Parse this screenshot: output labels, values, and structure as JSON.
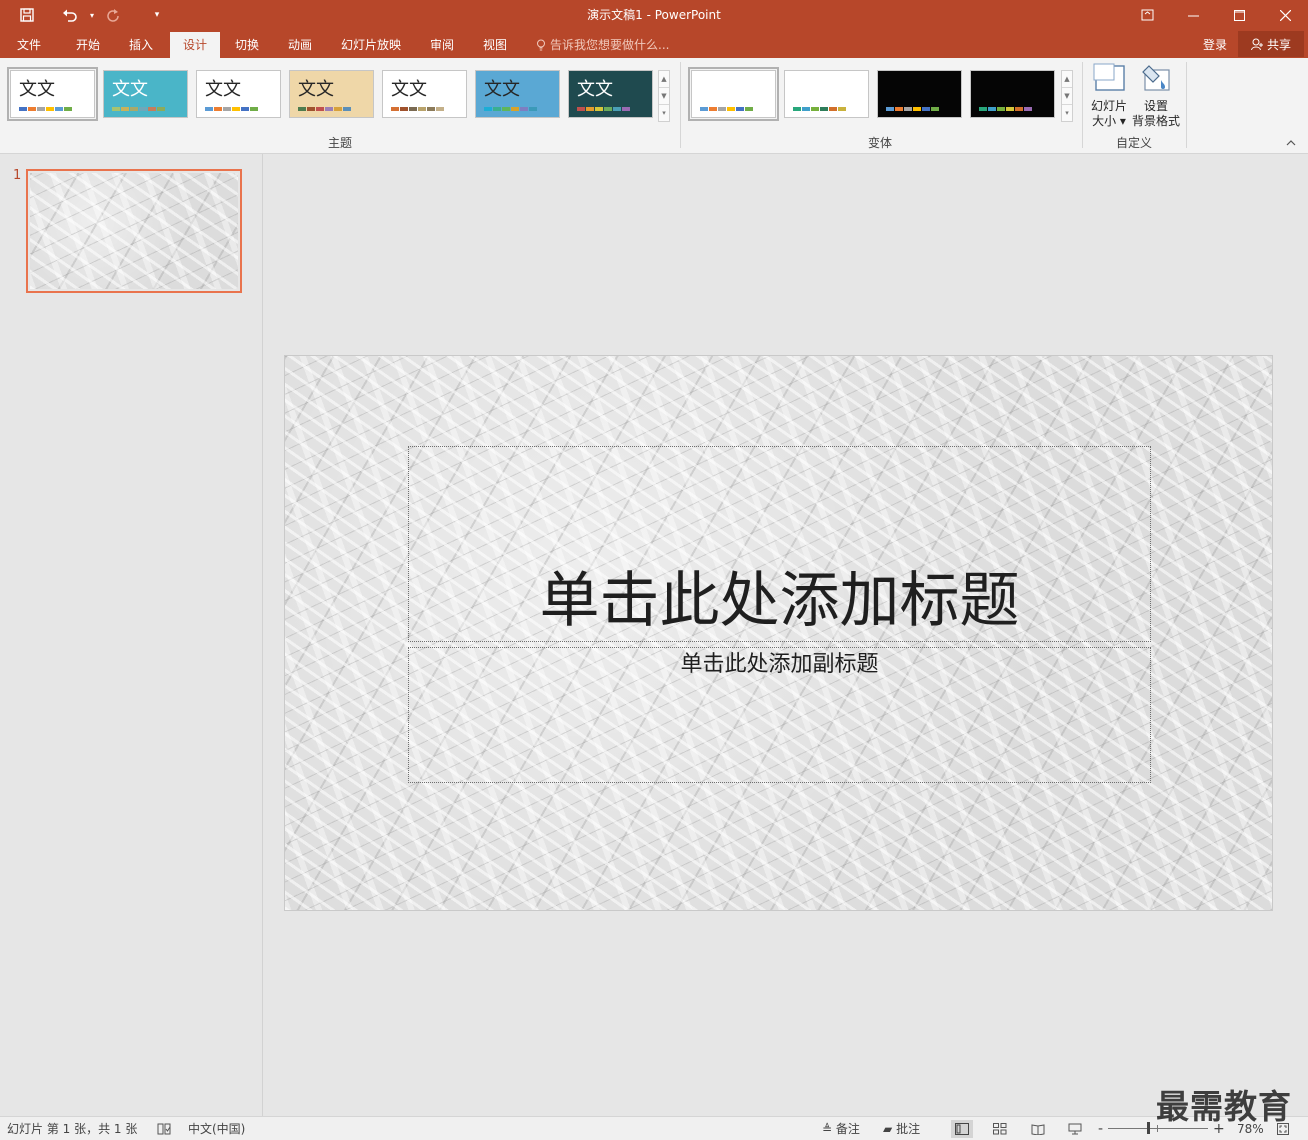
{
  "window": {
    "title": "演示文稿1 - PowerPoint"
  },
  "qat": {
    "save_icon": "save-icon",
    "undo_icon": "undo-icon",
    "redo_icon": "redo-icon",
    "customize_icon": "customize-qat-icon"
  },
  "tabs": [
    {
      "label": "文件",
      "active": false
    },
    {
      "label": "开始",
      "active": false
    },
    {
      "label": "插入",
      "active": false
    },
    {
      "label": "设计",
      "active": true
    },
    {
      "label": "切换",
      "active": false
    },
    {
      "label": "动画",
      "active": false
    },
    {
      "label": "幻灯片放映",
      "active": false
    },
    {
      "label": "审阅",
      "active": false
    },
    {
      "label": "视图",
      "active": false
    }
  ],
  "tell_me": {
    "placeholder": "告诉我您想要做什么..."
  },
  "account": {
    "login_label": "登录",
    "share_label": "共享"
  },
  "ribbon": {
    "themes_group_label": "主题",
    "themes": [
      {
        "sample_text": "文文",
        "bg": "#ffffff",
        "text_color": "#262626",
        "swatches": [
          "#4472c4",
          "#ed7d31",
          "#a5a5a5",
          "#ffc000",
          "#5b9bd5",
          "#70ad47"
        ]
      },
      {
        "sample_text": "文文",
        "bg": "#4ab5c8",
        "text_color": "#ffffff",
        "swatches": [
          "#a6c36f",
          "#c9b25b",
          "#a9a96a",
          "#6fa7b9",
          "#c67c5a",
          "#8cab5a"
        ]
      },
      {
        "sample_text": "文文",
        "bg": "#ffffff",
        "text_color": "#262626",
        "swatches": [
          "#5b9bd5",
          "#ed7d31",
          "#a5a5a5",
          "#ffc000",
          "#4472c4",
          "#70ad47"
        ]
      },
      {
        "sample_text": "文文",
        "bg": "#efd7a8",
        "text_color": "#262626",
        "swatches": [
          "#4e7c4e",
          "#a0522d",
          "#c0504d",
          "#9b7fb6",
          "#d8a13b",
          "#5b8fb9"
        ]
      },
      {
        "sample_text": "文文",
        "bg": "#ffffff",
        "text_color": "#262626",
        "swatches": [
          "#d57033",
          "#a0522d",
          "#7a6a52",
          "#b9a36b",
          "#8c7b5a",
          "#c4b089"
        ]
      },
      {
        "sample_text": "文文",
        "bg": "#5aa8d4",
        "text_color": "#262626",
        "swatches": [
          "#1cadd6",
          "#3aaf90",
          "#5fb65a",
          "#d7a32a",
          "#7e7ec1",
          "#3b9ab8"
        ]
      },
      {
        "sample_text": "文文",
        "bg": "#1f4a4f",
        "text_color": "#ffffff",
        "swatches": [
          "#c0504d",
          "#e59b2c",
          "#d6c73a",
          "#6cac5c",
          "#4a9fb6",
          "#9a6ab3"
        ]
      }
    ],
    "variants_group_label": "变体",
    "variants": [
      {
        "bg": "#ffffff",
        "swatches": [
          "#5b9bd5",
          "#ed7d31",
          "#a5a5a5",
          "#ffc000",
          "#4472c4",
          "#70ad47"
        ]
      },
      {
        "bg": "#ffffff",
        "swatches": [
          "#28a77b",
          "#3f9fca",
          "#76b03c",
          "#2e7d5a",
          "#d26f2a",
          "#c9b23c"
        ]
      },
      {
        "bg": "#050505",
        "swatches": [
          "#5b9bd5",
          "#ed7d31",
          "#a5a5a5",
          "#ffc000",
          "#4472c4",
          "#70ad47"
        ]
      },
      {
        "bg": "#050505",
        "swatches": [
          "#28a77b",
          "#3f9fca",
          "#76b03c",
          "#d6c73a",
          "#d26f2a",
          "#9a6ab3"
        ]
      }
    ],
    "customize_group_label": "自定义",
    "slide_size": {
      "line1": "幻灯片",
      "line2": "大小",
      "icon": "slide-size-icon"
    },
    "format_bg": {
      "line1": "设置",
      "line2": "背景格式",
      "icon": "format-background-icon"
    }
  },
  "slides_pane": {
    "slide_number": "1"
  },
  "slide": {
    "title_placeholder": "单击此处添加标题",
    "subtitle_placeholder": "单击此处添加副标题"
  },
  "statusbar": {
    "slide_info": "幻灯片 第 1 张，共 1 张",
    "language": "中文(中国)",
    "notes_label": "备注",
    "comments_label": "批注",
    "zoom_minus": "-",
    "zoom_plus": "+",
    "zoom_level": "78%"
  },
  "watermark": "最需教育",
  "colors": {
    "accent": "#b7472a",
    "selected_thumb_border": "#e9734d"
  }
}
